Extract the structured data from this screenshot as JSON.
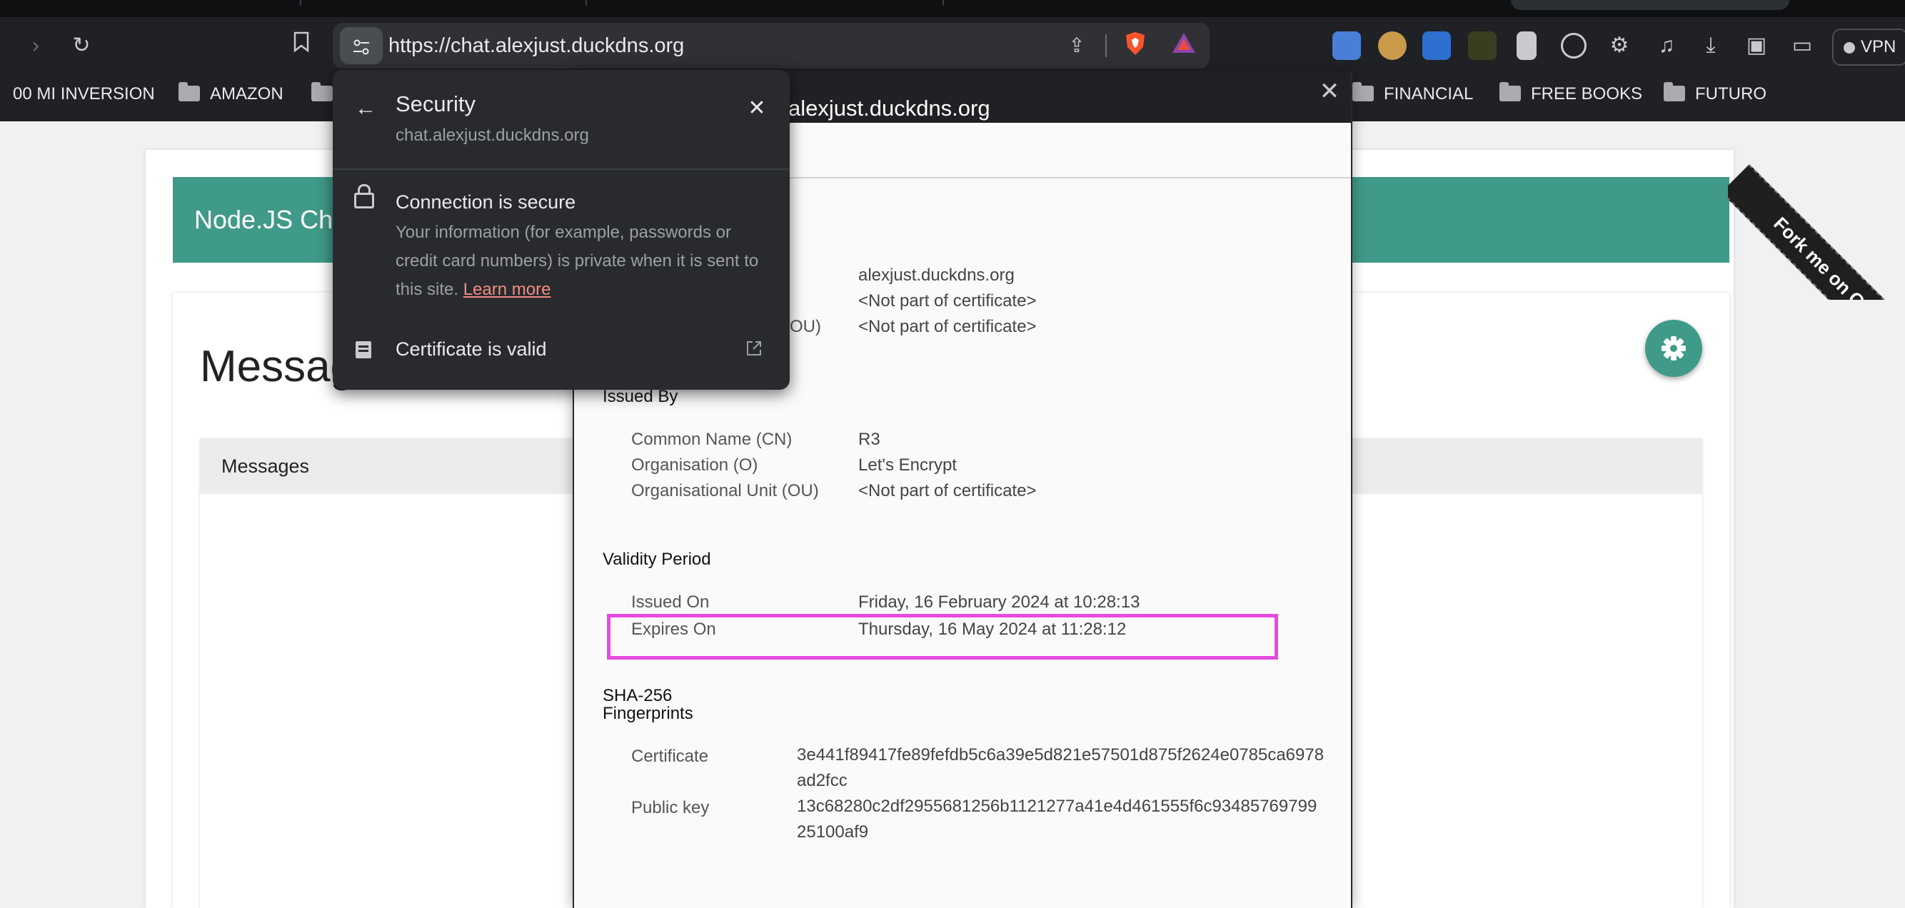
{
  "browser": {
    "url": "https://chat.alexjust.duckdns.org",
    "vpn_label": "VPN",
    "bookmarks": [
      "00 MI INVERSION",
      "AMAZON",
      "FINANCIAL",
      "FREE BOOKS",
      "FUTURO"
    ]
  },
  "page": {
    "app_title": "Node.JS Cha",
    "heading": "Messag",
    "messages_panel_title": "Messages",
    "ribbon_text": "Fork me on GitHub"
  },
  "cert_viewer": {
    "title": "alexjust.duckdns.org",
    "issued_to": {
      "rows": [
        {
          "label": ")",
          "value": "alexjust.duckdns.org"
        },
        {
          "label": "",
          "value": "<Not part of certificate>"
        },
        {
          "label": "(OU)",
          "value": "<Not part of certificate>"
        }
      ]
    },
    "issued_by": {
      "heading": "Issued By",
      "rows": [
        {
          "label": "Common Name (CN)",
          "value": "R3"
        },
        {
          "label": "Organisation (O)",
          "value": "Let's Encrypt"
        },
        {
          "label": "Organisational Unit (OU)",
          "value": "<Not part of certificate>"
        }
      ]
    },
    "validity": {
      "heading": "Validity Period",
      "issued_on_label": "Issued On",
      "issued_on": "Friday, 16 February 2024 at 10:28:13",
      "expires_on_label": "Expires On",
      "expires_on": "Thursday, 16 May 2024 at 11:28:12"
    },
    "fingerprints": {
      "heading_line1": "SHA-256",
      "heading_line2": "Fingerprints",
      "certificate_label": "Certificate",
      "certificate": "3e441f89417fe89fefdb5c6a39e5d821e57501d875f2624e0785ca6978ad2fcc",
      "public_key_label": "Public key",
      "public_key": "13c68280c2df2955681256b1121277a41e4d461555f6c9348576979925100af9"
    }
  },
  "security_popup": {
    "title": "Security",
    "domain": "chat.alexjust.duckdns.org",
    "connection_title": "Connection is secure",
    "connection_desc": "Your information (for example, passwords or credit card numbers) is private when it is sent to this site.",
    "learn_more": "Learn more",
    "certificate_status": "Certificate is valid"
  },
  "colors": {
    "accent_teal": "#409a89",
    "highlight_magenta": "#e64ae0",
    "chrome_dark": "#202124"
  }
}
